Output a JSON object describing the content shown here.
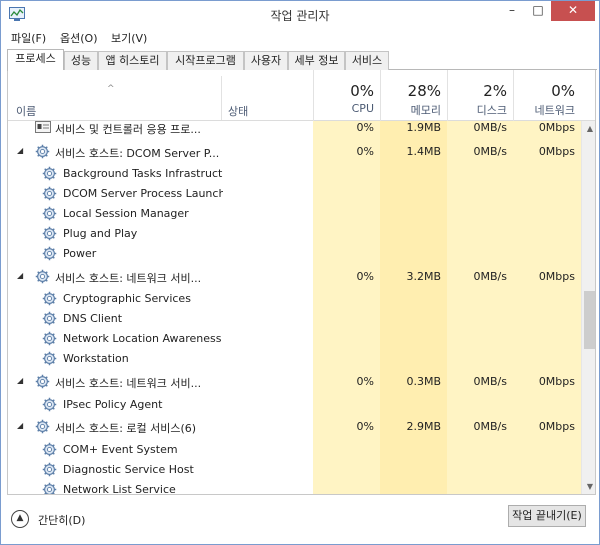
{
  "window": {
    "title": "작업 관리자",
    "min": "–",
    "max": "□",
    "close": "✕"
  },
  "menu": [
    "파일(F)",
    "옵션(O)",
    "보기(V)"
  ],
  "tabs": [
    "프로세스",
    "성능",
    "앱 히스토리",
    "시작프로그램",
    "사용자",
    "세부 정보",
    "서비스"
  ],
  "active_tab": "프로세스",
  "header": {
    "name": "이름",
    "status": "상태",
    "sort_glyph": "^",
    "cpu": {
      "pct": "0%",
      "label": "CPU"
    },
    "memory": {
      "pct": "28%",
      "label": "메모리"
    },
    "disk": {
      "pct": "2%",
      "label": "디스크"
    },
    "network": {
      "pct": "0%",
      "label": "네트워크"
    }
  },
  "rows": [
    {
      "type": "partial",
      "name": "서비스 및 컨트롤러 응용 프로...",
      "cpu": "0%",
      "mem": "1.9MB",
      "disk": "0MB/s",
      "net": "0Mbps"
    },
    {
      "type": "group",
      "name": "서비스 호스트: DCOM Server P...",
      "cpu": "0%",
      "mem": "1.4MB",
      "disk": "0MB/s",
      "net": "0Mbps",
      "expander": "◢"
    },
    {
      "type": "child",
      "name": "Background Tasks Infrastructu..."
    },
    {
      "type": "child",
      "name": "DCOM Server Process Launch..."
    },
    {
      "type": "child",
      "name": "Local Session Manager"
    },
    {
      "type": "child",
      "name": "Plug and Play"
    },
    {
      "type": "child",
      "name": "Power"
    },
    {
      "type": "group",
      "name": "서비스 호스트: 네트워크 서비...",
      "cpu": "0%",
      "mem": "3.2MB",
      "disk": "0MB/s",
      "net": "0Mbps",
      "expander": "◢"
    },
    {
      "type": "child",
      "name": "Cryptographic Services"
    },
    {
      "type": "child",
      "name": "DNS Client"
    },
    {
      "type": "child",
      "name": "Network Location Awareness"
    },
    {
      "type": "child",
      "name": "Workstation"
    },
    {
      "type": "group",
      "name": "서비스 호스트: 네트워크 서비...",
      "cpu": "0%",
      "mem": "0.3MB",
      "disk": "0MB/s",
      "net": "0Mbps",
      "expander": "◢"
    },
    {
      "type": "child",
      "name": "IPsec Policy Agent"
    },
    {
      "type": "group",
      "name": "서비스 호스트: 로컬 서비스(6)",
      "cpu": "0%",
      "mem": "2.9MB",
      "disk": "0MB/s",
      "net": "0Mbps",
      "expander": "◢"
    },
    {
      "type": "child",
      "name": "COM+ Event System"
    },
    {
      "type": "child",
      "name": "Diagnostic Service Host"
    },
    {
      "type": "child",
      "name": "Network List Service"
    }
  ],
  "footer": {
    "fewer_details": "간단히(D)",
    "end_task": "작업 끝내기(E)"
  },
  "colors": {
    "cpu_bg": "#fff4c4",
    "mem_bg": "#ffeeb0",
    "close_btn": "#c75050"
  }
}
